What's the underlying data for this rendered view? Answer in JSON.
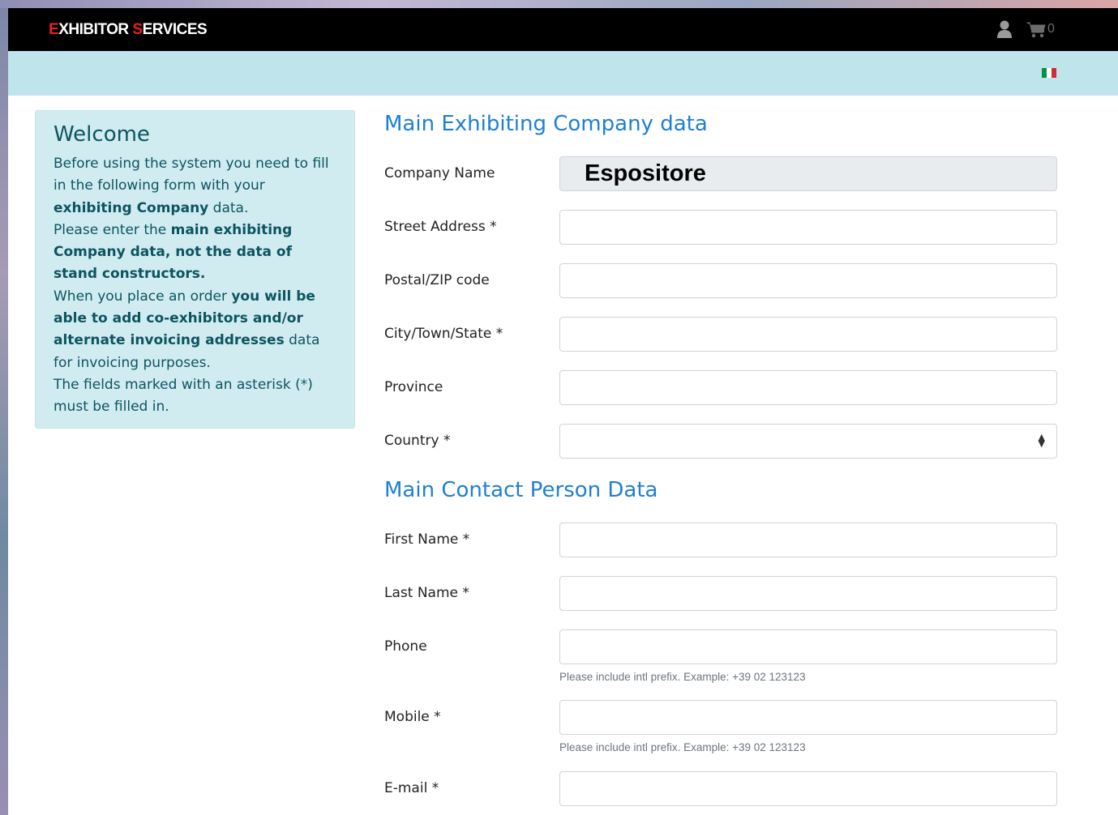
{
  "header": {
    "logo_part1_red": "E",
    "logo_part1_white": "XHIBITOR ",
    "logo_part2_red": "S",
    "logo_part2_white": "ERVICES",
    "cart_count": "0",
    "user_icon": "user-icon",
    "cart_icon": "shopping-cart-icon",
    "language_flag": "italy-flag-icon"
  },
  "welcome": {
    "title": "Welcome",
    "p1a": "Before using the system you need to fill in the following form with your ",
    "p1b": "exhibiting Company",
    "p1c": " data.",
    "p2a": "Please enter the ",
    "p2b": "main exhibiting Company data, not the data of stand constructors.",
    "p3a": "When you place an order ",
    "p3b": "you will be able to add co-exhibitors and/or alternate invoicing addresses",
    "p3c": " data for invoicing purposes.",
    "p4": "The fields marked with an asterisk (*) must be filled in."
  },
  "company_section": {
    "title": "Main Exhibiting Company data",
    "fields": [
      {
        "label": "Company Name",
        "value": "Espositore"
      },
      {
        "label": "Street Address *",
        "value": ""
      },
      {
        "label": "Postal/ZIP code",
        "value": ""
      },
      {
        "label": "City/Town/State *",
        "value": ""
      },
      {
        "label": "Province",
        "value": ""
      },
      {
        "label": "Country *",
        "value": ""
      }
    ]
  },
  "contact_section": {
    "title": "Main Contact Person Data",
    "fields": [
      {
        "label": "First Name *",
        "value": ""
      },
      {
        "label": "Last Name *",
        "value": ""
      },
      {
        "label": "Phone",
        "value": "",
        "help": "Please include intl prefix. Example: +39 02 123123"
      },
      {
        "label": "Mobile *",
        "value": "",
        "help": "Please include intl prefix. Example: +39 02 123123"
      },
      {
        "label": "E-mail *",
        "value": ""
      }
    ]
  },
  "colors": {
    "topbar": "#000000",
    "subbar": "#bfe4ec",
    "logo_accent": "#e5231b",
    "section_title": "#1e7fd6",
    "welcome_bg": "#d1ecf1",
    "welcome_text": "#0c5460"
  }
}
